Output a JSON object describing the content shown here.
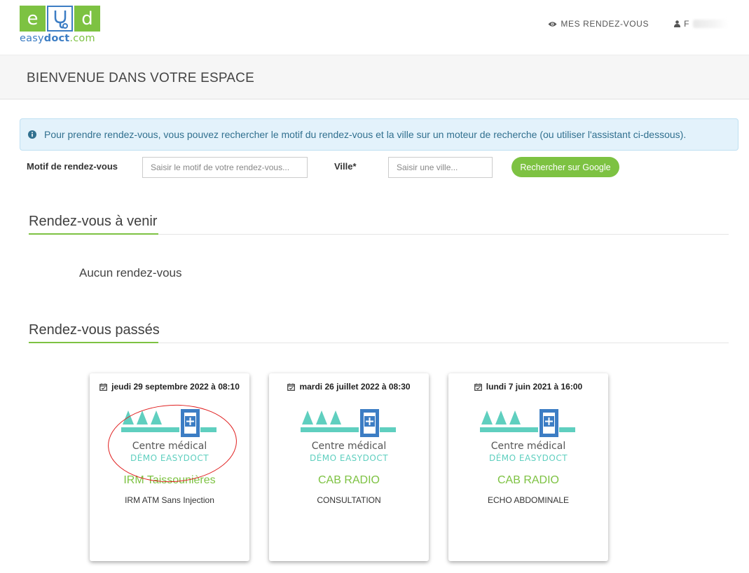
{
  "header": {
    "logo": {
      "letters": [
        "e",
        "d"
      ],
      "word_part1": "easy",
      "word_part2": "doct",
      "word_part3": ".com"
    },
    "nav": {
      "appointments_label": "MES RENDEZ-VOUS",
      "user_label": "F"
    }
  },
  "banner": {
    "title": "BIENVENUE DANS VOTRE ESPACE"
  },
  "alert": {
    "text": "Pour prendre rendez-vous, vous pouvez rechercher le motif du rendez-vous et la ville sur un moteur de recherche (ou utiliser l'assistant ci-dessous)."
  },
  "search": {
    "motif_label": "Motif de rendez-vous",
    "motif_placeholder": "Saisir le motif de votre rendez-vous...",
    "motif_value": "",
    "ville_label": "Ville*",
    "ville_placeholder": "Saisir une ville...",
    "ville_value": "",
    "button_label": "Rechercher sur Google"
  },
  "upcoming": {
    "title": "Rendez-vous à venir",
    "empty_text": "Aucun rendez-vous"
  },
  "past": {
    "title": "Rendez-vous passés",
    "cards": [
      {
        "date": "jeudi 29 septembre 2022 à 08:10",
        "logo_name": "Centre médical",
        "logo_sub": "DÉMO EASYDOCT",
        "center": "IRM Taissounières",
        "motif": "IRM ATM Sans Injection"
      },
      {
        "date": "mardi 26 juillet 2022 à 08:30",
        "logo_name": "Centre médical",
        "logo_sub": "DÉMO EASYDOCT",
        "center": "CAB RADIO",
        "motif": "CONSULTATION"
      },
      {
        "date": "lundi 7 juin 2021 à 16:00",
        "logo_name": "Centre médical",
        "logo_sub": "DÉMO EASYDOCT",
        "center": "CAB RADIO",
        "motif": "ECHO ABDOMINALE"
      }
    ]
  },
  "colors": {
    "brand_green": "#7dc242",
    "brand_blue": "#3c7dc4",
    "teal": "#5fcfbf",
    "info_text": "#31708f",
    "annotation_red": "#e02020"
  },
  "icons": {
    "nav_appointments": "eye-icon",
    "nav_user": "user-icon",
    "alert": "info-circle-icon",
    "card_date": "calendar-check-icon",
    "logo_middle": "stethoscope-icon",
    "card_logo": "medical-cross-icon"
  }
}
